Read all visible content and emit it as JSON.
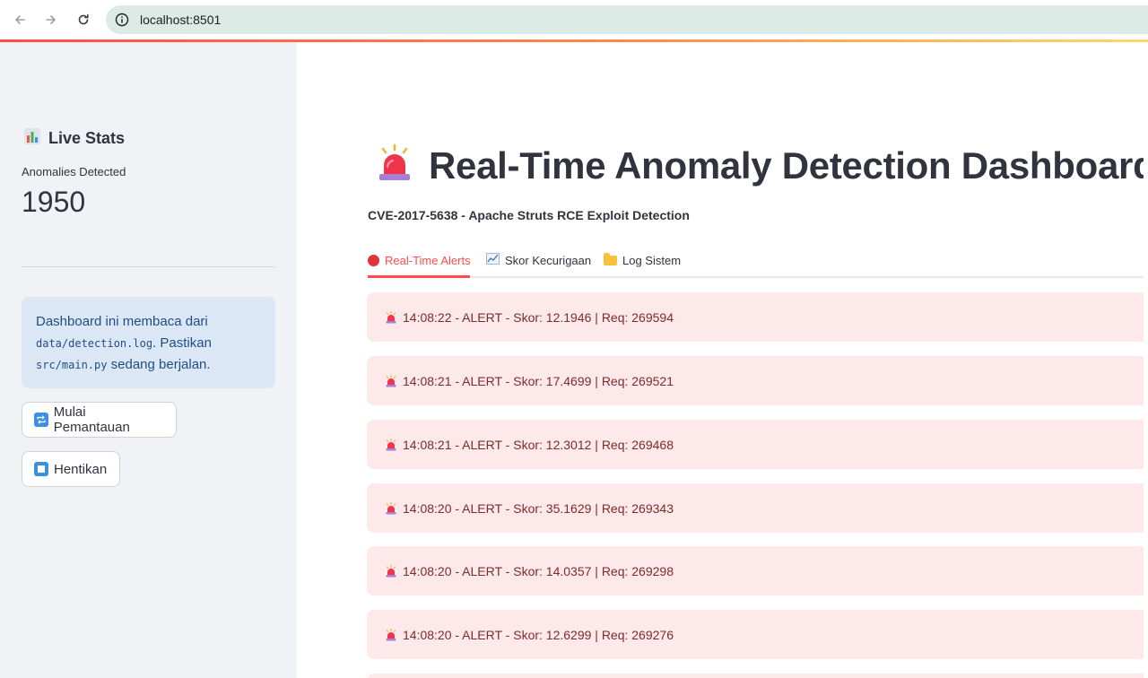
{
  "browser": {
    "url": "localhost:8501"
  },
  "sidebar": {
    "section_title": "Live Stats",
    "metric": {
      "label": "Anomalies Detected",
      "value": "1950"
    },
    "info": {
      "text_1": "Dashboard ini membaca dari ",
      "code_1": "data/detection.log",
      "text_2": ". Pastikan ",
      "code_2": "src/main.py",
      "text_3": " sedang berjalan."
    },
    "buttons": {
      "start": "Mulai Pemantauan",
      "stop": "Hentikan"
    }
  },
  "main": {
    "title": "Real-Time Anomaly Detection Dashboard",
    "subtitle": "CVE-2017-5638 - Apache Struts RCE Exploit Detection",
    "tabs": [
      {
        "label": "Real-Time Alerts",
        "icon": "red-circle-icon",
        "active": true
      },
      {
        "label": "Skor Kecurigaan",
        "icon": "chart-icon",
        "active": false
      },
      {
        "label": "Log Sistem",
        "icon": "folder-icon",
        "active": false
      }
    ],
    "alerts": [
      "14:08:22 - ALERT - Skor: 12.1946 | Req: 269594",
      "14:08:21 - ALERT - Skor: 17.4699 | Req: 269521",
      "14:08:21 - ALERT - Skor: 12.3012 | Req: 269468",
      "14:08:20 - ALERT - Skor: 35.1629 | Req: 269343",
      "14:08:20 - ALERT - Skor: 14.0357 | Req: 269298",
      "14:08:20 - ALERT - Skor: 12.6299 | Req: 269276"
    ]
  },
  "colors": {
    "accent": "#ff4b4b",
    "alert_bg": "#fde9ea",
    "alert_text": "#7d2b2b",
    "sidebar_bg": "#f0f2f6",
    "info_bg": "#dbe7f4"
  }
}
